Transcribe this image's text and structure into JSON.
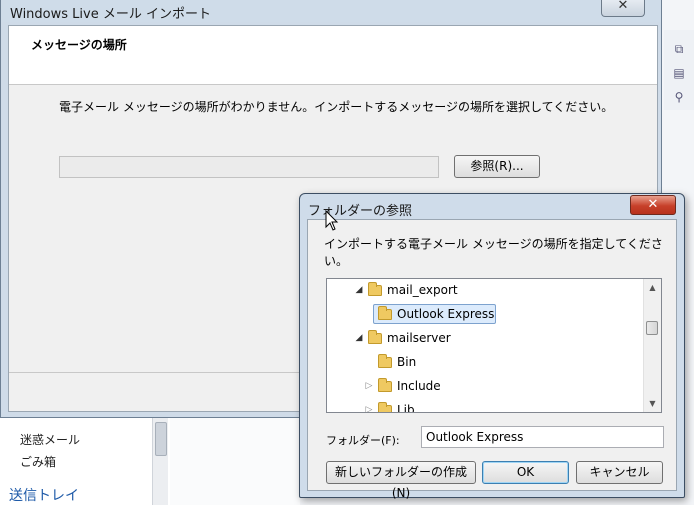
{
  "background_app": {
    "sidebar": {
      "items": [
        "迷惑メール",
        "ごみ箱"
      ],
      "section": "送信トレイ"
    },
    "toolbar_icons": [
      "copy-icon",
      "paste-icon",
      "find-icon"
    ]
  },
  "wizard": {
    "title": "Windows Live メール インポート",
    "close_glyph": "✕",
    "header_title": "メッセージの場所",
    "description": "電子メール メッセージの場所がわかりません。インポートするメッセージの場所を選択してください。",
    "path_value": "",
    "browse_label": "参照(R)..."
  },
  "dialog": {
    "title": "フォルダーの参照",
    "close_glyph": "✕",
    "instruction": "インポートする電子メール メッセージの場所を指定してください。",
    "tree": [
      {
        "label": "mail_export",
        "state": "expanded"
      },
      {
        "label": "Outlook Express",
        "state": "leaf",
        "selected": true
      },
      {
        "label": "mailserver",
        "state": "expanded"
      },
      {
        "label": "Bin",
        "state": "leaf"
      },
      {
        "label": "Include",
        "state": "collapsed"
      },
      {
        "label": "Lib",
        "state": "collapsed"
      }
    ],
    "folder_label": "フォルダー(F):",
    "folder_value": "Outlook Express",
    "new_folder_label": "新しいフォルダーの作成(N)",
    "ok_label": "OK",
    "cancel_label": "キャンセル"
  }
}
